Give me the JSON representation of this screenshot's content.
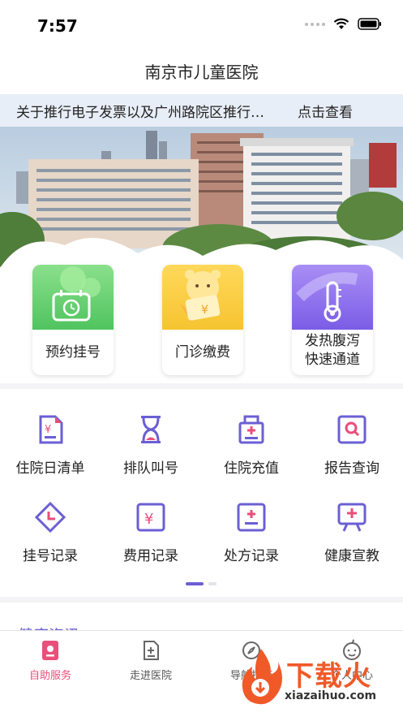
{
  "status": {
    "time": "7:57"
  },
  "nav": {
    "title": "南京市儿童医院"
  },
  "notice": {
    "text": "关于推行电子发票以及广州路院区推行…",
    "action": "点击查看"
  },
  "quick": [
    {
      "label_line1": "预约挂号",
      "label_line2": ""
    },
    {
      "label_line1": "门诊缴费",
      "label_line2": ""
    },
    {
      "label_line1": "发热腹泻",
      "label_line2": "快速通道"
    }
  ],
  "grid": [
    {
      "label": "住院日清单",
      "icon": "bill-icon"
    },
    {
      "label": "排队叫号",
      "icon": "hourglass-icon"
    },
    {
      "label": "住院充值",
      "icon": "recharge-icon"
    },
    {
      "label": "报告查询",
      "icon": "report-search-icon"
    },
    {
      "label": "挂号记录",
      "icon": "clock-diamond-icon"
    },
    {
      "label": "费用记录",
      "icon": "yen-box-icon"
    },
    {
      "label": "处方记录",
      "icon": "prescription-icon"
    },
    {
      "label": "健康宣教",
      "icon": "easel-icon"
    }
  ],
  "next_section": {
    "title": "健康资讯"
  },
  "tabs": [
    {
      "label": "自助服务",
      "icon": "self-service-icon",
      "active": true
    },
    {
      "label": "走进医院",
      "icon": "hospital-doc-icon",
      "active": false
    },
    {
      "label": "导航指南",
      "icon": "compass-icon",
      "active": false
    },
    {
      "label": "个人中心",
      "icon": "baby-face-icon",
      "active": false
    }
  ],
  "watermark": {
    "text": "下载火",
    "url": "xiazaihuo.com"
  },
  "colors": {
    "accent": "#6b5fd4",
    "tab_active": "#e94f7a",
    "watermark": "#f05a28"
  }
}
